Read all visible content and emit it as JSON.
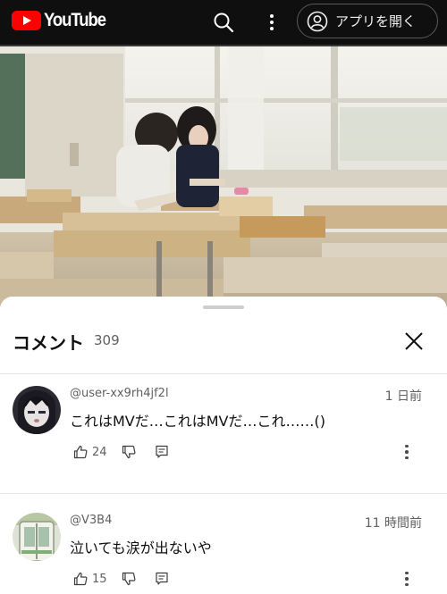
{
  "header": {
    "logo_text": "YouTube",
    "open_app_label": "アプリを開く",
    "icons": {
      "search": "search-icon",
      "more": "more-vert-icon",
      "account": "account-circle-icon"
    }
  },
  "video": {
    "description_icon": "video-frame"
  },
  "comments_panel": {
    "title": "コメント",
    "count": "309",
    "close_icon": "close-icon",
    "comments": [
      {
        "handle": "@user-xx9rh4jf2l",
        "time": "1 日前",
        "text": "これはMVだ…これはMVだ…これ……()",
        "likes": "24"
      },
      {
        "handle": "@V3B4",
        "time": "11 時間前",
        "text": "泣いても涙が出ないや",
        "likes": "15"
      }
    ]
  },
  "colors": {
    "brand_red": "#ff0000",
    "bar_bg": "#0f0f0f",
    "sheet_bg": "#ffffff",
    "secondary_text": "#606060"
  }
}
